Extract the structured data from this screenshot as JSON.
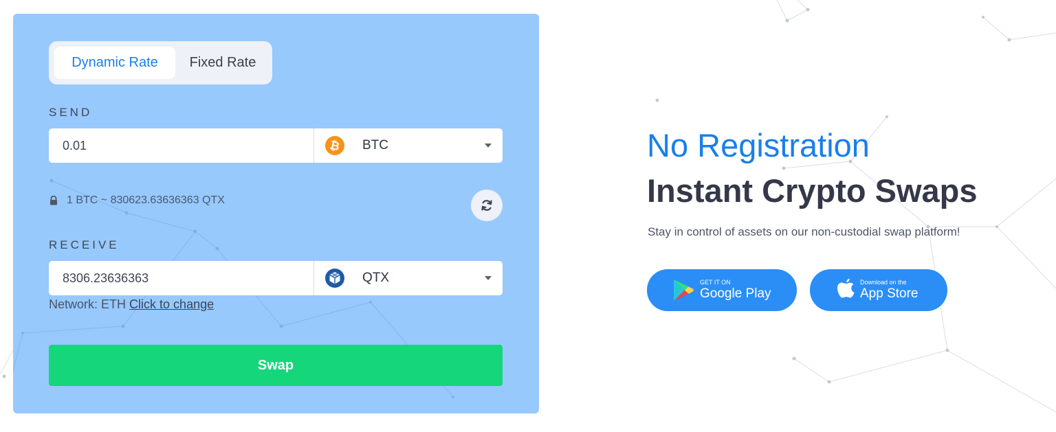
{
  "rate_toggle": {
    "dynamic_label": "Dynamic Rate",
    "fixed_label": "Fixed Rate",
    "active": "dynamic"
  },
  "send": {
    "label": "SEND",
    "amount": "0.01",
    "coin": {
      "symbol": "BTC",
      "icon": "bitcoin-icon",
      "color": "#f7931a"
    }
  },
  "rate": {
    "text": "1 BTC ~ 830623.63636363 QTX",
    "lock_icon": "lock-icon",
    "refresh_icon": "refresh-icon"
  },
  "receive": {
    "label": "RECEIVE",
    "amount": "8306.23636363",
    "coin": {
      "symbol": "QTX",
      "icon": "qtx-cube-icon",
      "color": "#1e5aa8"
    },
    "network_prefix": "Network: ETH",
    "network_link": "Click to change"
  },
  "swap_button": "Swap",
  "hero": {
    "title_line1": "No Registration",
    "title_line2": "Instant Crypto Swaps",
    "subtitle": "Stay in control of assets on our non-custodial swap platform!"
  },
  "stores": {
    "google": {
      "small": "GET IT ON",
      "big": "Google Play",
      "icon": "google-play-icon"
    },
    "apple": {
      "small": "Download on the",
      "big": "App Store",
      "icon": "apple-icon"
    }
  },
  "colors": {
    "card_background": "#97c9fd",
    "accent_blue": "#1a7fe8",
    "swap_green": "#15d67a",
    "store_button_blue": "#2a8ef6"
  }
}
